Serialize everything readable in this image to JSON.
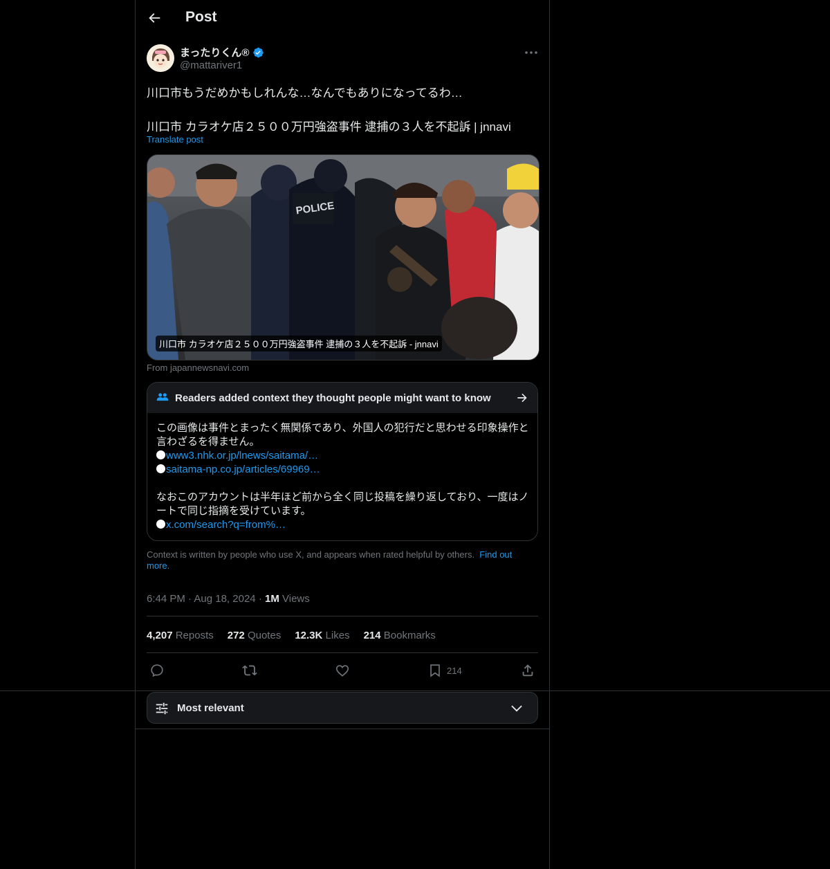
{
  "header": {
    "title": "Post"
  },
  "author": {
    "name": "まったりくん®",
    "handle": "@mattariver1"
  },
  "post": {
    "line1": "川口市もうだめかもしれんな…なんでもありになってるわ…",
    "line2": "川口市 カラオケ店２５００万円強盗事件 逮捕の３人を不起訴 | jnnavi",
    "translate": "Translate post"
  },
  "link_card": {
    "caption": "川口市 カラオケ店２５００万円強盗事件 逮捕の３人を不起訴 - jnnavi",
    "from": "From japannewsnavi.com",
    "image_text": "POLICE"
  },
  "community_note": {
    "title": "Readers added context they thought people might want to know",
    "para1": "この画像は事件とまったく無関係であり、外国人の犯行だと思わせる印象操作と言わざるを得ません。",
    "link1": "www3.nhk.or.jp/lnews/saitama/…",
    "link2": "saitama-np.co.jp/articles/69969…",
    "para2": "なおこのアカウントは半年ほど前から全く同じ投稿を繰り返しており、一度はノートで同じ指摘を受けています。",
    "link3": "x.com/search?q=from%…"
  },
  "context_footer": {
    "text": "Context is written by people who use X, and appears when rated helpful by others.",
    "link": "Find out more."
  },
  "meta": {
    "time": "6:44 PM",
    "date": "Aug 18, 2024",
    "views_count": "1M",
    "views_label": "Views",
    "dot": "·"
  },
  "stats": {
    "reposts_count": "4,207",
    "reposts_label": "Reposts",
    "quotes_count": "272",
    "quotes_label": "Quotes",
    "likes_count": "12.3K",
    "likes_label": "Likes",
    "bookmarks_count": "214",
    "bookmarks_label": "Bookmarks"
  },
  "actions": {
    "bookmark_count": "214"
  },
  "sort": {
    "label": "Most relevant"
  },
  "colors": {
    "accent": "#1d9bf0",
    "verified": "#1d9bf0",
    "bg": "#000000",
    "border": "#2f3336",
    "muted": "#71767b"
  }
}
